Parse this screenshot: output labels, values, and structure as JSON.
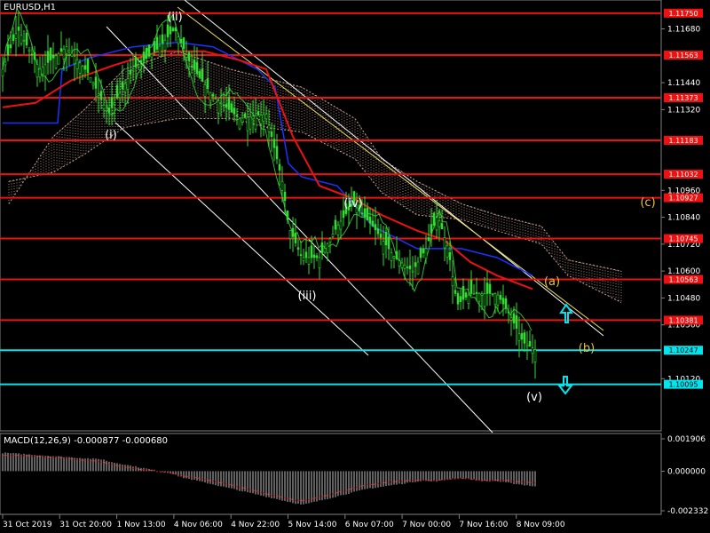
{
  "symbol_title": "EURUSD,H1",
  "macd_title": "MACD(12,26,9) -0.000877 -0.000680",
  "colors": {
    "background": "#000000",
    "candles": "#33dd33",
    "resistance": "#ee1111",
    "support": "#00e5ee",
    "ma_red": "#ee1111",
    "ma_blue": "#1a33ff",
    "rsi_line": "#33cc33",
    "cloud": "#c8a08c",
    "wave_white": "#ffffff",
    "wave_yellow": "#e8c43c",
    "arrow": "#00e5ee",
    "channel": "#ffffff",
    "channel_yellow": "#f0e060"
  },
  "chart_data": {
    "type": "line",
    "price_axis": {
      "ticks": [
        "1.11680",
        "1.11440",
        "1.11320",
        "1.10960",
        "1.10840",
        "1.10720",
        "1.10600",
        "1.10480",
        "1.10360",
        "1.10120"
      ],
      "ylim": [
        1.09939,
        1.11777
      ]
    },
    "macd_axis": {
      "ticks": [
        "0.001906",
        "0.000000",
        "-0.002332"
      ],
      "ylim": [
        -0.002332,
        0.001906
      ]
    },
    "time_axis": {
      "labels": [
        "31 Oct 2019",
        "31 Oct 20:00",
        "1 Nov 13:00",
        "4 Nov 06:00",
        "4 Nov 22:00",
        "5 Nov 14:00",
        "6 Nov 07:00",
        "7 Nov 00:00",
        "7 Nov 16:00",
        "8 Nov 09:00"
      ]
    },
    "resistance_levels": [
      {
        "value": 1.1175,
        "label": "1.11750"
      },
      {
        "value": 1.11563,
        "label": "1.11563"
      },
      {
        "value": 1.11373,
        "label": "1.11373"
      },
      {
        "value": 1.11183,
        "label": "1.11183"
      },
      {
        "value": 1.11032,
        "label": "1.11032"
      },
      {
        "value": 1.10927,
        "label": "1.10927"
      },
      {
        "value": 1.10745,
        "label": "1.10745"
      },
      {
        "value": 1.10563,
        "label": "1.10563"
      },
      {
        "value": 1.10381,
        "label": "1.10381"
      }
    ],
    "support_levels": [
      {
        "value": 1.10247,
        "label": "1.10247"
      },
      {
        "value": 1.10095,
        "label": "1.10095"
      }
    ],
    "wave_labels": [
      "(i)",
      "(ii)",
      "(iii)",
      "(iv)",
      "(v)",
      "(a)",
      "(b)",
      "(c)"
    ]
  }
}
